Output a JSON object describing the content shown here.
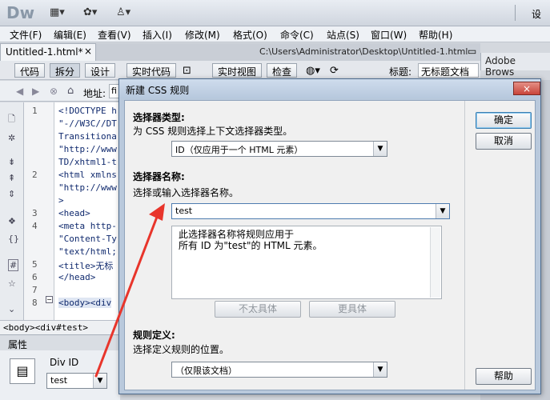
{
  "app": {
    "logo": "Dw",
    "settings_partial": "设"
  },
  "menu": [
    "文件(F)",
    "编辑(E)",
    "查看(V)",
    "插入(I)",
    "修改(M)",
    "格式(O)",
    "命令(C)",
    "站点(S)",
    "窗口(W)",
    "帮助(H)"
  ],
  "doc_tab": {
    "label": "Untitled-1.html*",
    "close": "×"
  },
  "doc_path": "C:\\Users\\Administrator\\Desktop\\Untitled-1.html",
  "side_panel_title": "Adobe Brows",
  "view_buttons": {
    "code": "代码",
    "split": "拆分",
    "design": "设计",
    "live_code": "实时代码",
    "live_view": "实时视图",
    "inspect": "检查"
  },
  "title_label": "标题:",
  "title_value": "无标题文档",
  "address_label": "地址:",
  "address_value": "fi",
  "line_numbers": [
    "1",
    "2",
    "3",
    "4",
    "5",
    "6",
    "7",
    "8"
  ],
  "code_lines": [
    "<!DOCTYPE h",
    "\"-//W3C//DT",
    "Transitiona",
    "\"http://www",
    "TD/xhtml1-t",
    "<html xmlns",
    "\"http://www",
    ">",
    "<head>",
    "<meta http-",
    "\"Content-Ty",
    "\"text/html;",
    "<title>无标",
    "</head>",
    "<body><div"
  ],
  "tag_path": "<body><div#test>",
  "properties": {
    "tab_label": "属性",
    "div_id_label": "Div ID",
    "div_id_value": "test"
  },
  "dialog": {
    "title": "新建 CSS 规则",
    "close": "×",
    "selector_type_title": "选择器类型:",
    "selector_type_hint": "为 CSS 规则选择上下文选择器类型。",
    "selector_type_value": "ID（仅应用于一个 HTML 元素）",
    "selector_name_title": "选择器名称:",
    "selector_name_hint": "选择或输入选择器名称。",
    "selector_name_value": "test",
    "description_line1": "此选择器名称将规则应用于",
    "description_line2": "所有 ID 为\"test\"的 HTML 元素。",
    "less_specific": "不太具体",
    "more_specific": "更具体",
    "rule_def_title": "规则定义:",
    "rule_def_hint": "选择定义规则的位置。",
    "rule_def_value": "（仅限该文档）",
    "ok": "确定",
    "cancel": "取消",
    "help": "帮助"
  },
  "colors": {
    "annotation_arrow": "#e8352b",
    "dialog_border": "#4d6b8e"
  }
}
